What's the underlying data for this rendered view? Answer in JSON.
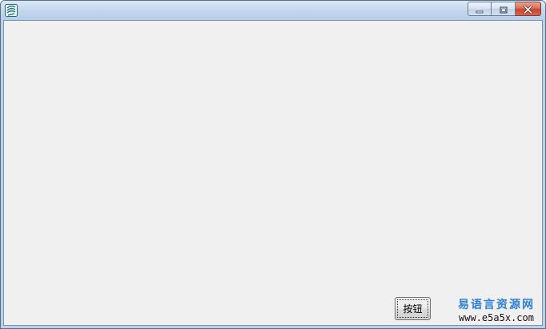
{
  "window": {
    "title": "",
    "icon": "app-logo-icon",
    "controls": [
      "minimize-icon",
      "maximize-icon",
      "close-icon"
    ]
  },
  "content": {
    "button_label": "按钮"
  },
  "watermark": {
    "site_name": "易语言资源网",
    "url": "www.e5a5x.com",
    "color": "#2f7fd6"
  }
}
